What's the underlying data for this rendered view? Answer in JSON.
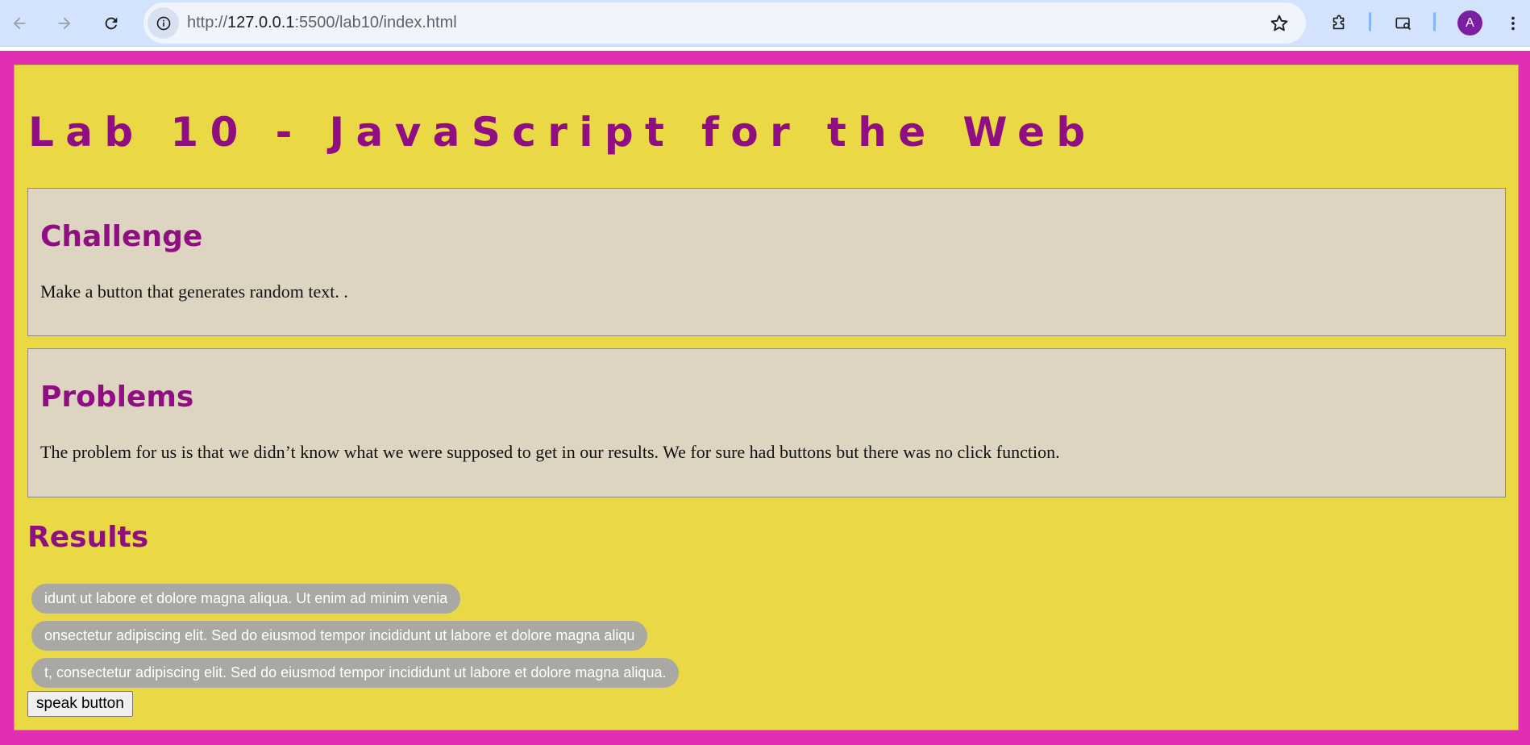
{
  "browser": {
    "back_icon": "arrow-left-icon",
    "forward_icon": "arrow-right-icon",
    "reload_icon": "reload-icon",
    "url_scheme": "http://",
    "url_host": "127.0.0.1",
    "url_rest": ":5500/lab10/index.html",
    "avatar_letter": "A"
  },
  "page": {
    "title": "Lab 10 - JavaScript for the Web",
    "challenge": {
      "heading": "Challenge",
      "text": "Make a button that generates random text. ."
    },
    "problems": {
      "heading": "Problems",
      "text": "The problem for us is that we didn’t know what we were supposed to get in our results. We for sure had buttons but there was no click function."
    },
    "results": {
      "heading": "Results",
      "items": [
        "idunt ut labore et dolore magna aliqua. Ut enim ad minim venia",
        "onsectetur adipiscing elit. Sed do eiusmod tempor incididunt ut labore et dolore magna aliqu",
        "t, consectetur adipiscing elit. Sed do eiusmod tempor incididunt ut labore et dolore magna aliqua."
      ],
      "button_label": "speak button"
    }
  },
  "colors": {
    "outer_background": "#e12fb5",
    "page_background": "#ebd845",
    "heading_color": "#8f0f82",
    "card_background": "#ddd5c1",
    "pill_background": "#a9a8a2"
  }
}
